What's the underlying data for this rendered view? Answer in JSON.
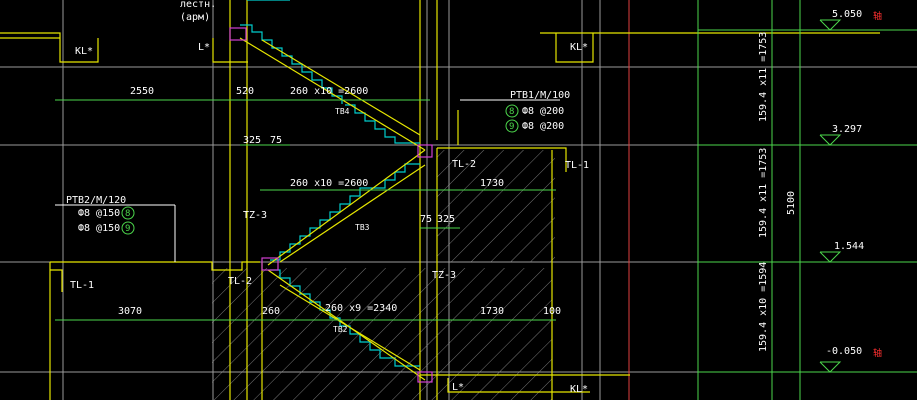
{
  "colors": {
    "background": "#000000",
    "wall": "#e6e600",
    "dimension": "#4cd64c",
    "grid": "#9a9a9a",
    "stair": "#00cccc",
    "text": "#ffffff",
    "axis_red": "#e04040",
    "joint": "#d040d0",
    "elevation_mark": "#ff3030"
  },
  "labels": {
    "top_note_1": "лестн.",
    "top_note_2": "(арм)",
    "kl_left": "KL*",
    "l_left": "L*",
    "kl_right": "KL*",
    "dim_2550": "2550",
    "dim_520": "520",
    "tread_upper": "260 x10 =2600",
    "tb_upper": "TB4",
    "ptb1": "PTB1/M/100",
    "reb_8_top": "8",
    "reb_8_top_text": "Ф8 @200",
    "reb_9_top": "9",
    "reb_9_top_text": "Ф8 @200",
    "dim_325_top": "325",
    "dim_75_top": "75",
    "tl2_upper": "TL-2",
    "tl1_upper": "TL-1",
    "tread_mid": "260 x10 =2600",
    "dim_1730_mid": "1730",
    "ptb2": "PTB2/M/120",
    "reb_8_left_text": "Ф8 @150",
    "reb_8_left": "8",
    "reb_9_left_text": "Ф8 @150",
    "reb_9_left": "9",
    "tz3_left": "TZ-3",
    "tb_mid": "TB3",
    "dim_75_mid": "75",
    "dim_325_mid": "325",
    "tl1_left": "TL-1",
    "tl2_lower": "TL-2",
    "tz3_right": "TZ-3",
    "dim_3070": "3070",
    "dim_260": "260",
    "tread_lower": "260 x9 =2340",
    "dim_1730_low": "1730",
    "dim_100": "100",
    "tb_lower": "TB2",
    "l_bottom": "L*",
    "kl_bottom": "KL*"
  },
  "elevations": {
    "el_top": "5.050",
    "el_2": "3.297",
    "el_3": "1.544",
    "el_bottom": "-0.050",
    "riser_upper": "159.4 x11 =1753",
    "riser_mid": "159.4 x11 =1753",
    "riser_lower": "159.4 x10 =1594",
    "total_height": "5100",
    "axis_mark_top": "轴",
    "axis_mark_bottom": "轴"
  }
}
